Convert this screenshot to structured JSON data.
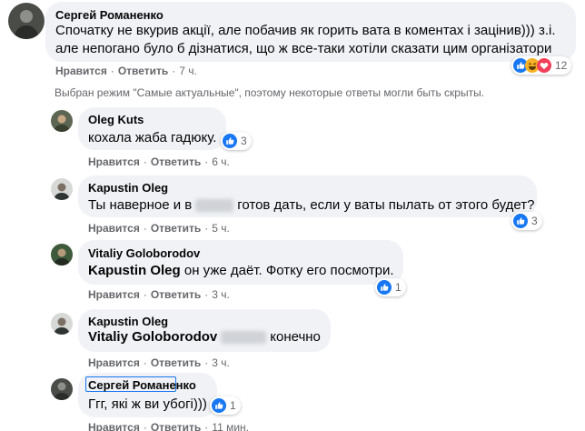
{
  "top_comment": {
    "author": "Сергей Романенко",
    "line1": "Спочатку не вкурив акції, але побачив як горить вата в коментах і зацінив))) з.і.",
    "line2": "але непогано було б дізнатися, що ж все-таки хотіли сказати цим організатори",
    "like_label": "Нравится",
    "reply_label": "Ответить",
    "time": "7 ч.",
    "reaction_count": "12",
    "reactions": [
      "like-icon",
      "haha-icon",
      "love-icon"
    ]
  },
  "notice": "Выбран режим \"Самые актуальные\", поэтому некоторые ответы могли быть скрыты.",
  "replies": [
    {
      "author": "Oleg Kuts",
      "text": "кохала жаба гадюку.",
      "like_label": "Нравится",
      "reply_label": "Ответить",
      "time": "6 ч.",
      "reaction_count": "3"
    },
    {
      "author": "Kapustin Oleg",
      "text_before": "Ты наверное и в",
      "text_after": "готов дать, если у ваты пылать от этого будет?",
      "like_label": "Нравится",
      "reply_label": "Ответить",
      "time": "5 ч.",
      "reaction_count": "3"
    },
    {
      "author": "Vitaliy Goloborodov",
      "mention": "Kapustin Oleg",
      "text": "он уже даёт. Фотку его посмотри.",
      "like_label": "Нравится",
      "reply_label": "Ответить",
      "time": "3 ч.",
      "reaction_count": "1"
    },
    {
      "author": "Kapustin Oleg",
      "mention": "Vitaliy Goloborodov",
      "text": "конечно",
      "like_label": "Нравится",
      "reply_label": "Ответить",
      "time": "3 ч."
    },
    {
      "author": "Сергей Романенко",
      "text": "Ггг, які ж ви убогі)))",
      "like_label": "Нравится",
      "reply_label": "Ответить",
      "time": "11 мин.",
      "reaction_count": "1"
    }
  ],
  "colors": {
    "like_blue": "#1877f2",
    "bubble_bg": "#f0f2f5",
    "meta_gray": "#65676b",
    "haha_yellow": "#f7b125",
    "love_red": "#f33e58"
  }
}
